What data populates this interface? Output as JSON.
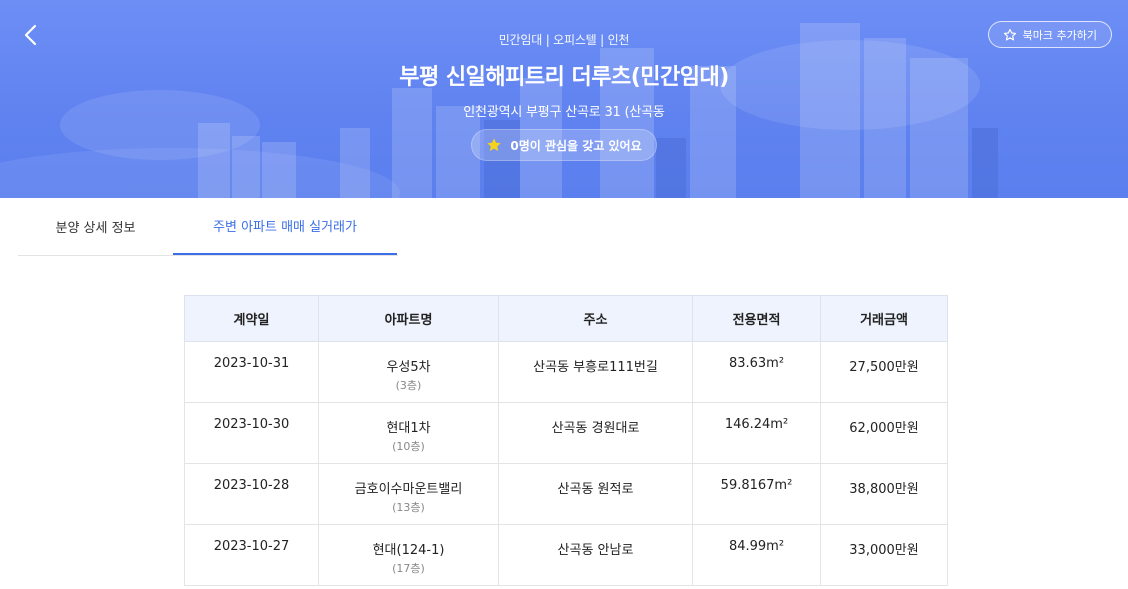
{
  "header": {
    "category": "민간임대 | 오피스텔 | 인천",
    "title": "부평 신일해피트리 더루츠(민간임대)",
    "address": "인천광역시 부평구 산곡로 31 (산곡동",
    "interest_text": "0명이 관심을 갖고 있어요",
    "bookmark_label": "북마크 추가하기"
  },
  "tabs": [
    {
      "label": "분양 상세 정보",
      "active": false
    },
    {
      "label": "주변 아파트 매매 실거래가",
      "active": true
    }
  ],
  "table": {
    "columns": [
      "계약일",
      "아파트명",
      "주소",
      "전용면적",
      "거래금액"
    ],
    "rows": [
      {
        "date": "2023-10-31",
        "name": "우성5차",
        "floor": "(3층)",
        "address": "산곡동 부흥로111번길",
        "area": "83.63m²",
        "price": "27,500만원"
      },
      {
        "date": "2023-10-30",
        "name": "현대1차",
        "floor": "(10층)",
        "address": "산곡동 경원대로",
        "area": "146.24m²",
        "price": "62,000만원"
      },
      {
        "date": "2023-10-28",
        "name": "금호이수마운트밸리",
        "floor": "(13층)",
        "address": "산곡동 원적로",
        "area": "59.8167m²",
        "price": "38,800만원"
      },
      {
        "date": "2023-10-27",
        "name": "현대(124-1)",
        "floor": "(17층)",
        "address": "산곡동 안남로",
        "area": "84.99m²",
        "price": "33,000만원"
      }
    ]
  },
  "colors": {
    "accent": "#3b6ee8",
    "hero": "#6d8ef5",
    "header_bg": "#eef3fd",
    "star": "#f7d21b"
  }
}
